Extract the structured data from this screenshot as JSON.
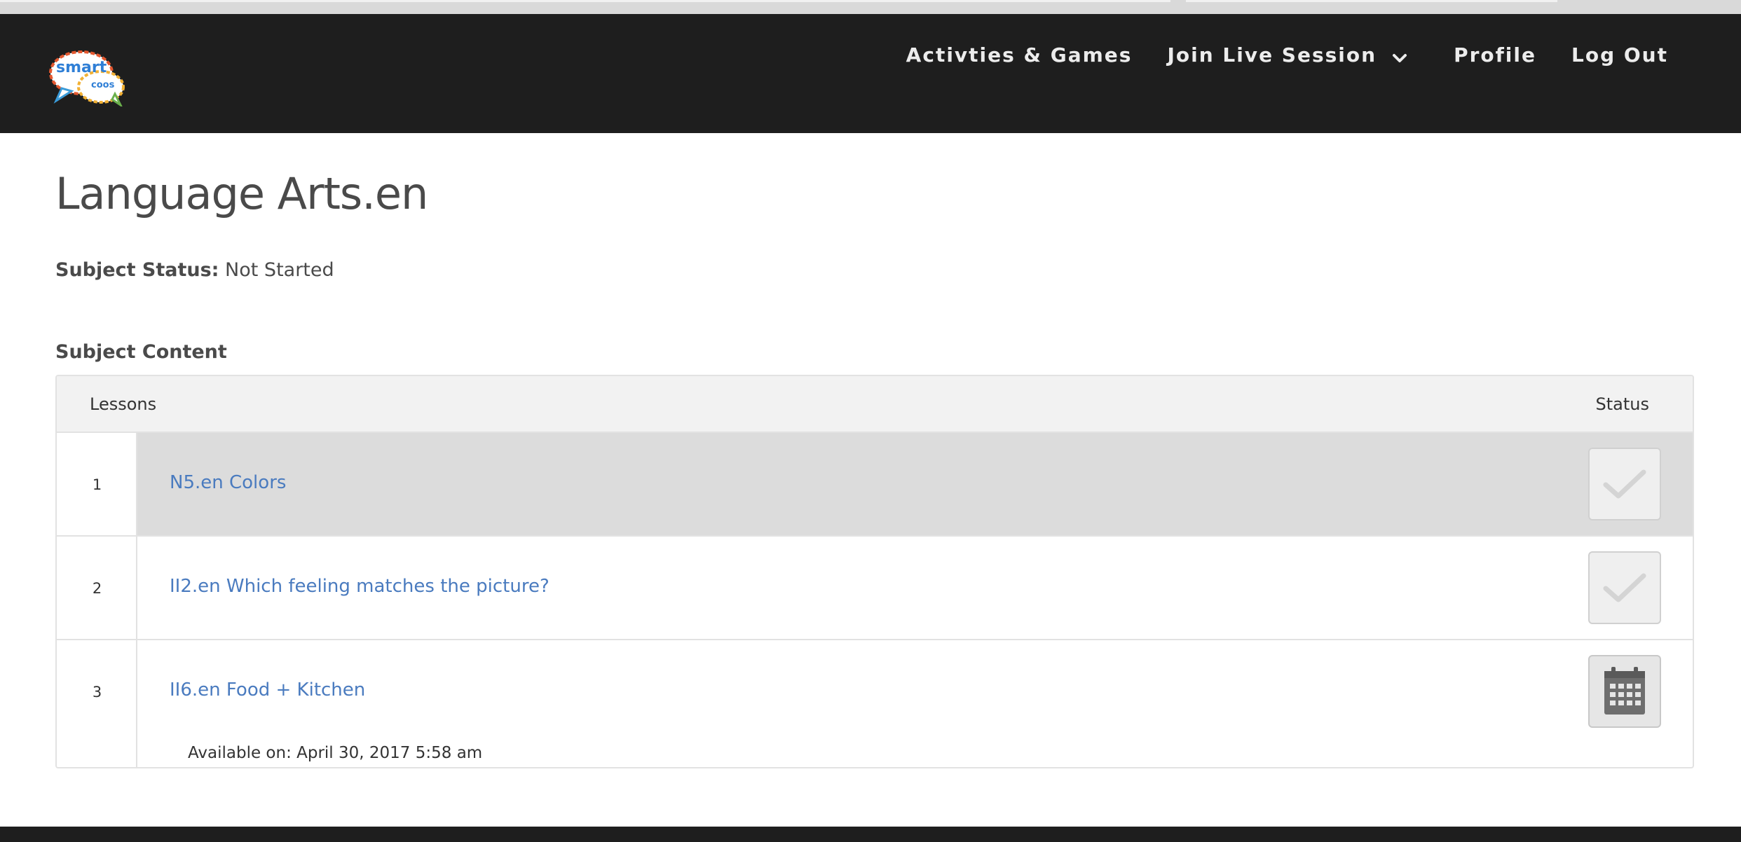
{
  "nav": {
    "logo_line1": "smart",
    "logo_line2": "coos",
    "items": [
      {
        "label": "Activties & Games"
      },
      {
        "label": "Join Live Session"
      },
      {
        "label": "Profile"
      },
      {
        "label": "Log Out"
      }
    ]
  },
  "page": {
    "title": "Language Arts.en",
    "status_label": "Subject Status:",
    "status_value": "Not Started",
    "section_heading": "Subject Content"
  },
  "table": {
    "headers": {
      "lessons": "Lessons",
      "status": "Status"
    },
    "rows": [
      {
        "number": "1",
        "title": "N5.en Colors",
        "status_icon": "check-icon"
      },
      {
        "number": "2",
        "title": "II2.en Which feeling matches the picture?",
        "status_icon": "check-icon"
      },
      {
        "number": "3",
        "title": "II6.en Food + Kitchen",
        "available": "Available on: April 30, 2017 5:58 am",
        "status_icon": "calendar-icon"
      }
    ]
  },
  "colors": {
    "nav_bg": "#1e1e1e",
    "link": "#4a7bbf",
    "highlight_row": "#dcdcdc"
  }
}
